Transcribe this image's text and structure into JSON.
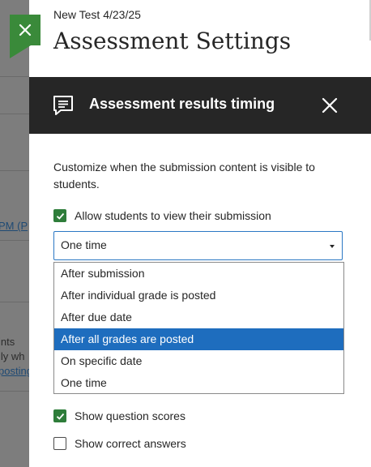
{
  "background": {
    "lines": [
      "PM (P",
      "ints",
      "lly wh",
      "posting"
    ]
  },
  "outer_header": {
    "subtitle": "New Test 4/23/25",
    "title": "Assessment Settings"
  },
  "panel": {
    "title": "Assessment results timing",
    "description": "Customize when the submission content is visible to students.",
    "allow_view_label": "Allow students to view their submission",
    "allow_view_checked": true,
    "select_value": "One time",
    "options": [
      "After submission",
      "After individual grade is posted",
      "After due date",
      "After all grades are posted",
      "On specific date",
      "One time"
    ],
    "highlighted_option": "After all grades are posted",
    "show_scores_label": "Show question scores",
    "show_scores_checked": true,
    "show_correct_label": "Show correct answers",
    "show_correct_checked": false
  },
  "colors": {
    "header_bg": "#262626",
    "accent_green": "#2e7d3a",
    "selected_blue": "#1e6dbe",
    "focus_blue": "#2b78c4"
  },
  "icons": {
    "close_flag": "close-icon",
    "header": "document-comment-icon",
    "panel_close": "close-icon",
    "check": "checkmark-icon",
    "caret": "caret-down-icon"
  }
}
